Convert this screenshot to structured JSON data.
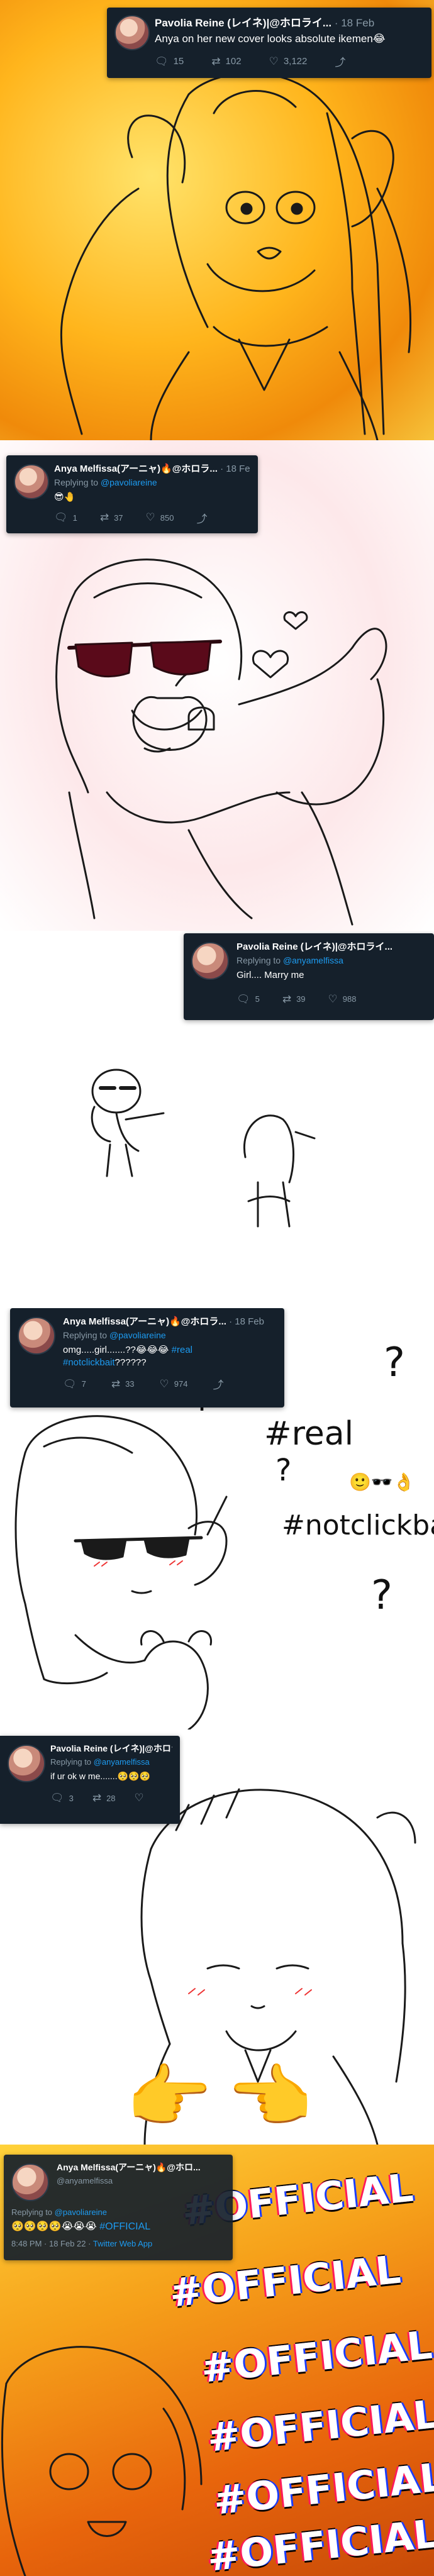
{
  "panels": [
    {
      "tweet": {
        "author": "Pavolia Reine (レイネ)|@ホロライ...",
        "date": "· 18 Feb",
        "text": "Anya on her new cover looks absolute ikemen😂",
        "reply_count": "15",
        "retweet_count": "102",
        "like_count": "3,122"
      },
      "colors": {
        "background": "#f6b41a"
      }
    },
    {
      "tweet": {
        "author": "Anya Melfissa(アーニャ)🔥@ホロラ...",
        "date": "· 18 Feb",
        "reply_prefix": "Replying to",
        "reply_handle": "@pavoliareine",
        "text": "😎🤚",
        "reply_count": "1",
        "retweet_count": "37",
        "like_count": "850"
      },
      "colors": {
        "background": "#fde8ea",
        "accent": "#c0122e"
      }
    },
    {
      "tweet": {
        "author": "Pavolia Reine (レイネ)|@ホロライ...",
        "date": "",
        "reply_prefix": "Replying to",
        "reply_handle": "@anyamelfissa",
        "text": "Girl.... Marry me",
        "reply_count": "5",
        "retweet_count": "39",
        "like_count": "988"
      }
    },
    {
      "tweet": {
        "author": "Anya Melfissa(アーニャ)🔥@ホロラ...",
        "date": "· 18 Feb",
        "reply_prefix": "Replying to",
        "reply_handle": "@pavoliareine",
        "text_plain": "omg.....girl.......??😂😂😂",
        "hashtag_1": "#real",
        "hashtag_2": "#notclickbait",
        "text_tail": "??????",
        "reply_count": "7",
        "retweet_count": "33",
        "like_count": "974"
      },
      "handwriting": {
        "q1": "?",
        "q2": "?",
        "q3": "?",
        "q4": "?",
        "real": "#real",
        "notclickbait": "#notclickbait",
        "emojis": "🙂🕶️👌"
      }
    },
    {
      "tweet": {
        "author": "Pavolia Reine (レイネ)|@ホロライ...",
        "date": "",
        "reply_prefix": "Replying to",
        "reply_handle": "@anyamelfissa",
        "text": "if ur ok w me.......🥺🥺🥺",
        "reply_count": "3",
        "retweet_count": "28",
        "like_count": ""
      },
      "emojis": {
        "left": "👉",
        "right": "👈"
      }
    },
    {
      "tweet": {
        "author": "Anya Melfissa(アーニャ)🔥@ホロ...",
        "handle": "@anyamelfissa",
        "reply_prefix": "Replying to",
        "reply_handle": "@pavoliareine",
        "text": "🥺🥺🥺🥺😭😭😭",
        "hashtag": "#OFFICIAL",
        "meta_time": "8:48 PM · 18 Feb 22 · ",
        "meta_app": "Twitter Web App"
      },
      "overlay": {
        "word": "#OFFICIAL"
      },
      "colors": {
        "background": "#f07a10"
      }
    }
  ],
  "icons": {
    "reply": "reply-icon",
    "retweet": "retweet-icon",
    "like": "heart-icon",
    "share": "share-icon"
  }
}
